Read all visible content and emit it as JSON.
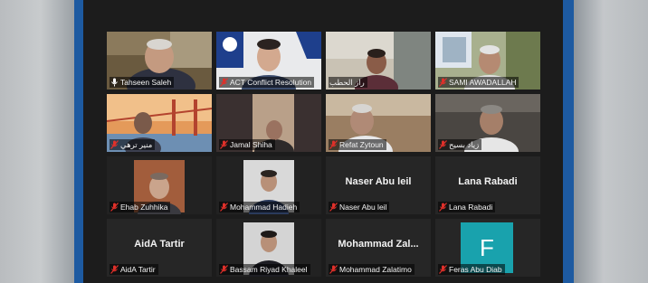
{
  "meeting": {
    "participants": [
      {
        "name": "Tahseen Saleh",
        "muted": false,
        "video": true,
        "active": true
      },
      {
        "name": "ACT Conflict Resolution",
        "muted": true,
        "video": true
      },
      {
        "name": "راز الحطب",
        "muted": false,
        "video": true
      },
      {
        "name": "SAMI AWADALLAH",
        "muted": true,
        "video": true
      },
      {
        "name": "منير ترهي",
        "muted": true,
        "video": true
      },
      {
        "name": "Jamal Shiha",
        "muted": true,
        "video": true
      },
      {
        "name": "Refat Zytoun",
        "muted": true,
        "video": true
      },
      {
        "name": "زياد بسيح",
        "muted": true,
        "video": true
      },
      {
        "name": "Ehab Zuhhika",
        "muted": true,
        "video": true
      },
      {
        "name": "Mohammad Hadieh",
        "muted": true,
        "video": true
      },
      {
        "name": "Naser Abu leil",
        "muted": true,
        "video": false,
        "display_name": "Naser Abu leil"
      },
      {
        "name": "Lana Rabadi",
        "muted": true,
        "video": false,
        "display_name": "Lana Rabadi"
      },
      {
        "name": "AidA Tartir",
        "muted": true,
        "video": false,
        "display_name": "AidA Tartir"
      },
      {
        "name": "Bassam Riyad Khaleel",
        "muted": true,
        "video": true
      },
      {
        "name": "Mohammad Zalatimo",
        "muted": true,
        "video": false,
        "display_name": "Mohammad  Zal..."
      },
      {
        "name": "Feras Abu Diab",
        "muted": true,
        "video": false,
        "avatar_letter": "F",
        "avatar_color": "#19a2ad"
      }
    ]
  },
  "colors": {
    "window_frame": "#1d5aa1",
    "active_speaker_outline": "#c7d42a",
    "muted_icon": "#e0302a"
  }
}
